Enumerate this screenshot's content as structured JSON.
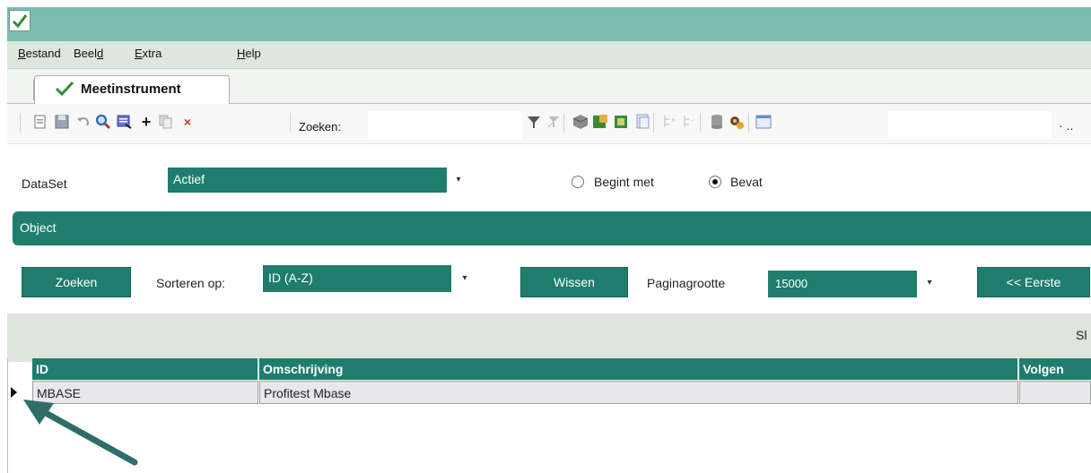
{
  "menu": {
    "items": [
      {
        "pre": "",
        "u": "B",
        "post": "estand"
      },
      {
        "pre": "Beel",
        "u": "d",
        "post": ""
      },
      {
        "pre": "",
        "u": "E",
        "post": "xtra"
      },
      {
        "pre": "",
        "u": "H",
        "post": "elp"
      }
    ]
  },
  "tab": {
    "label": "Meetinstrument"
  },
  "toolbar": {
    "search_label": "Zoeken:",
    "search_value": "",
    "right_value": "",
    "overflow": "· .."
  },
  "form": {
    "dataset_label": "DataSet",
    "dataset_value": "Actief",
    "radio_begint": "Begint met",
    "radio_bevat": "Bevat",
    "selected_radio": "Bevat"
  },
  "panel": {
    "title": "Object"
  },
  "filter": {
    "search_button": "Zoeken",
    "sort_label": "Sorteren op:",
    "sort_value": "ID (A-Z)",
    "clear_button": "Wissen",
    "pagesize_label": "Paginagrootte",
    "pagesize_value": "15000",
    "first_button": "<< Eerste"
  },
  "grid": {
    "corner_text": "Sl",
    "columns": [
      "ID",
      "Omschrijving",
      "Volgen"
    ],
    "rows": [
      {
        "id": "MBASE",
        "omschrijving": "Profitest Mbase",
        "volgen": ""
      }
    ]
  },
  "colors": {
    "teal": "#1f7d6e",
    "titlebar": "#7dbcb0",
    "arrow": "#2e6d68"
  }
}
